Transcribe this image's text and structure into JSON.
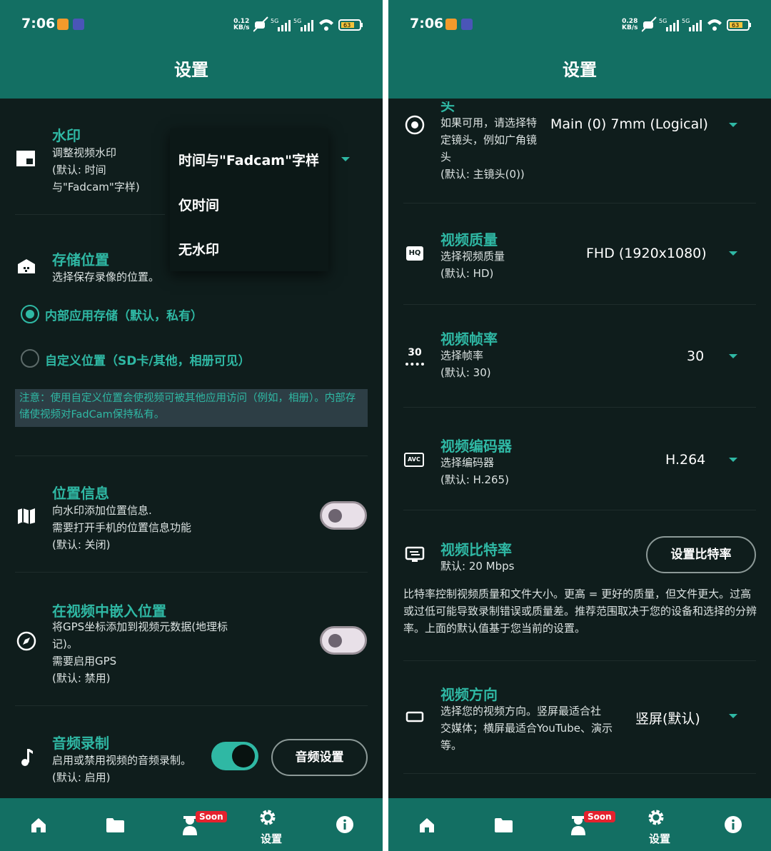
{
  "status": {
    "time": "7:06",
    "left_kbs": "0.12",
    "right_kbs": "0.28",
    "kbs_unit": "KB/s",
    "battery": "63"
  },
  "appbar": {
    "title": "设置"
  },
  "left": {
    "watermark": {
      "title": "水印",
      "desc": "调整视频水印",
      "default1": "(默认: 时间",
      "default2": "与\"Fadcam\"字样)"
    },
    "watermark_options": [
      "时间与\"Fadcam\"字样",
      "仅时间",
      "无水印"
    ],
    "storage": {
      "title": "存储位置",
      "desc": "选择保存录像的位置。",
      "option_internal": "内部应用存储（默认，私有）",
      "option_custom": "自定义位置（SD卡/其他，相册可见）",
      "note": "注意：使用自定义位置会使视频可被其他应用访问（例如，相册）。内部存储使视频对FadCam保持私有。"
    },
    "location": {
      "title": "位置信息",
      "desc1": "向水印添加位置信息.",
      "desc2": "需要打开手机的位置信息功能",
      "default": "(默认: 关闭)"
    },
    "embed_location": {
      "title": "在视频中嵌入位置",
      "desc1": "将GPS坐标添加到视频元数据(地理标",
      "desc2": "记)。",
      "desc3": "需要启用GPS",
      "default": "(默认: 禁用)"
    },
    "audio": {
      "title": "音频录制",
      "desc": "启用或禁用视频的音频录制。",
      "default": "(默认: 启用)",
      "button": "音频设置"
    }
  },
  "right": {
    "lens": {
      "title_tail": "头",
      "desc1": "如果可用，请选择特",
      "desc2": "定镜头，例如广角镜",
      "desc3": "头",
      "default": "(默认: 主镜头(0))",
      "value": "Main (0) 7mm (Logical)"
    },
    "quality": {
      "title": "视频质量",
      "desc": "选择视频质量",
      "default": "(默认: HD)",
      "value": "FHD (1920x1080)",
      "icon_text": "HQ"
    },
    "framerate": {
      "title": "视频帧率",
      "desc": "选择帧率",
      "default": "(默认: 30)",
      "value": "30",
      "icon_text": "30"
    },
    "codec": {
      "title": "视频编码器",
      "desc": "选择编码器",
      "default": "(默认: H.265)",
      "value": "H.264",
      "icon_text": "AVC"
    },
    "bitrate": {
      "title": "视频比特率",
      "default": "默认: 20 Mbps",
      "button": "设置比特率",
      "note": "比特率控制视频质量和文件大小。更高 = 更好的质量，但文件更大。过高或过低可能导致录制错误或质量差。推荐范围取决于您的设备和选择的分辨率。上面的默认值基于您当前的设置。"
    },
    "orientation": {
      "title": "视频方向",
      "desc1": "选择您的视频方向。竖屏最适合社",
      "desc2": "交媒体；横屏最适合YouTube、演示",
      "desc3": "等。",
      "value": "竖屏(默认)"
    }
  },
  "nav": {
    "soon_badge": "Soon",
    "settings_label": "设置"
  },
  "colors": {
    "primary": "#136f63",
    "accent": "#2fb8a4",
    "background": "#0f1d1c"
  }
}
